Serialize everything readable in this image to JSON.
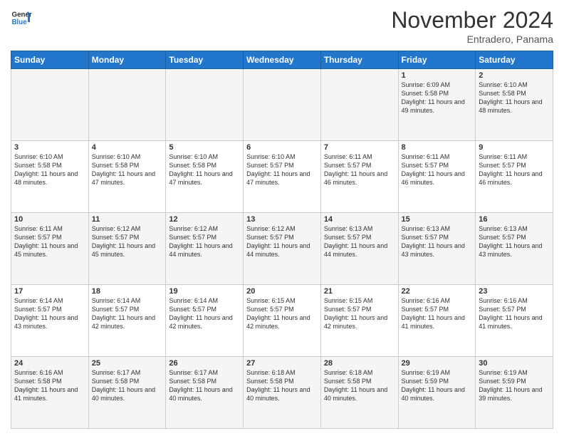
{
  "logo": {
    "line1": "General",
    "line2": "Blue"
  },
  "header": {
    "month": "November 2024",
    "location": "Entradero, Panama"
  },
  "weekdays": [
    "Sunday",
    "Monday",
    "Tuesday",
    "Wednesday",
    "Thursday",
    "Friday",
    "Saturday"
  ],
  "weeks": [
    [
      {
        "day": "",
        "info": ""
      },
      {
        "day": "",
        "info": ""
      },
      {
        "day": "",
        "info": ""
      },
      {
        "day": "",
        "info": ""
      },
      {
        "day": "",
        "info": ""
      },
      {
        "day": "1",
        "info": "Sunrise: 6:09 AM\nSunset: 5:58 PM\nDaylight: 11 hours and 49 minutes."
      },
      {
        "day": "2",
        "info": "Sunrise: 6:10 AM\nSunset: 5:58 PM\nDaylight: 11 hours and 48 minutes."
      }
    ],
    [
      {
        "day": "3",
        "info": "Sunrise: 6:10 AM\nSunset: 5:58 PM\nDaylight: 11 hours and 48 minutes."
      },
      {
        "day": "4",
        "info": "Sunrise: 6:10 AM\nSunset: 5:58 PM\nDaylight: 11 hours and 47 minutes."
      },
      {
        "day": "5",
        "info": "Sunrise: 6:10 AM\nSunset: 5:58 PM\nDaylight: 11 hours and 47 minutes."
      },
      {
        "day": "6",
        "info": "Sunrise: 6:10 AM\nSunset: 5:57 PM\nDaylight: 11 hours and 47 minutes."
      },
      {
        "day": "7",
        "info": "Sunrise: 6:11 AM\nSunset: 5:57 PM\nDaylight: 11 hours and 46 minutes."
      },
      {
        "day": "8",
        "info": "Sunrise: 6:11 AM\nSunset: 5:57 PM\nDaylight: 11 hours and 46 minutes."
      },
      {
        "day": "9",
        "info": "Sunrise: 6:11 AM\nSunset: 5:57 PM\nDaylight: 11 hours and 46 minutes."
      }
    ],
    [
      {
        "day": "10",
        "info": "Sunrise: 6:11 AM\nSunset: 5:57 PM\nDaylight: 11 hours and 45 minutes."
      },
      {
        "day": "11",
        "info": "Sunrise: 6:12 AM\nSunset: 5:57 PM\nDaylight: 11 hours and 45 minutes."
      },
      {
        "day": "12",
        "info": "Sunrise: 6:12 AM\nSunset: 5:57 PM\nDaylight: 11 hours and 44 minutes."
      },
      {
        "day": "13",
        "info": "Sunrise: 6:12 AM\nSunset: 5:57 PM\nDaylight: 11 hours and 44 minutes."
      },
      {
        "day": "14",
        "info": "Sunrise: 6:13 AM\nSunset: 5:57 PM\nDaylight: 11 hours and 44 minutes."
      },
      {
        "day": "15",
        "info": "Sunrise: 6:13 AM\nSunset: 5:57 PM\nDaylight: 11 hours and 43 minutes."
      },
      {
        "day": "16",
        "info": "Sunrise: 6:13 AM\nSunset: 5:57 PM\nDaylight: 11 hours and 43 minutes."
      }
    ],
    [
      {
        "day": "17",
        "info": "Sunrise: 6:14 AM\nSunset: 5:57 PM\nDaylight: 11 hours and 43 minutes."
      },
      {
        "day": "18",
        "info": "Sunrise: 6:14 AM\nSunset: 5:57 PM\nDaylight: 11 hours and 42 minutes."
      },
      {
        "day": "19",
        "info": "Sunrise: 6:14 AM\nSunset: 5:57 PM\nDaylight: 11 hours and 42 minutes."
      },
      {
        "day": "20",
        "info": "Sunrise: 6:15 AM\nSunset: 5:57 PM\nDaylight: 11 hours and 42 minutes."
      },
      {
        "day": "21",
        "info": "Sunrise: 6:15 AM\nSunset: 5:57 PM\nDaylight: 11 hours and 42 minutes."
      },
      {
        "day": "22",
        "info": "Sunrise: 6:16 AM\nSunset: 5:57 PM\nDaylight: 11 hours and 41 minutes."
      },
      {
        "day": "23",
        "info": "Sunrise: 6:16 AM\nSunset: 5:57 PM\nDaylight: 11 hours and 41 minutes."
      }
    ],
    [
      {
        "day": "24",
        "info": "Sunrise: 6:16 AM\nSunset: 5:58 PM\nDaylight: 11 hours and 41 minutes."
      },
      {
        "day": "25",
        "info": "Sunrise: 6:17 AM\nSunset: 5:58 PM\nDaylight: 11 hours and 40 minutes."
      },
      {
        "day": "26",
        "info": "Sunrise: 6:17 AM\nSunset: 5:58 PM\nDaylight: 11 hours and 40 minutes."
      },
      {
        "day": "27",
        "info": "Sunrise: 6:18 AM\nSunset: 5:58 PM\nDaylight: 11 hours and 40 minutes."
      },
      {
        "day": "28",
        "info": "Sunrise: 6:18 AM\nSunset: 5:58 PM\nDaylight: 11 hours and 40 minutes."
      },
      {
        "day": "29",
        "info": "Sunrise: 6:19 AM\nSunset: 5:59 PM\nDaylight: 11 hours and 40 minutes."
      },
      {
        "day": "30",
        "info": "Sunrise: 6:19 AM\nSunset: 5:59 PM\nDaylight: 11 hours and 39 minutes."
      }
    ]
  ]
}
